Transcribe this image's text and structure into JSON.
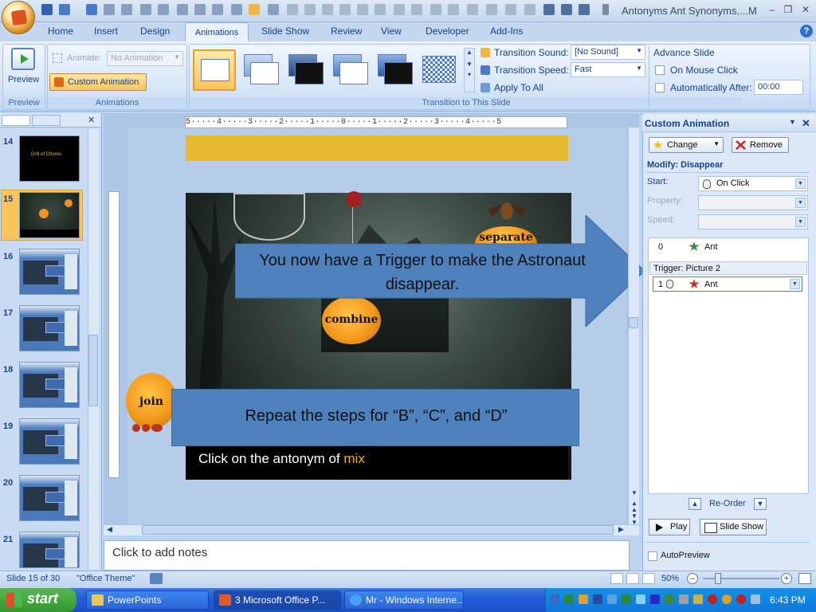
{
  "window": {
    "title": "Antonyms Ant Synonyms....M",
    "buttons": [
      "minimize",
      "restore",
      "close"
    ]
  },
  "ribbon_tabs": [
    "Home",
    "Insert",
    "Design",
    "Animations",
    "Slide Show",
    "Review",
    "View",
    "Developer",
    "Add-Ins"
  ],
  "active_tab": "Animations",
  "ribbon": {
    "preview": {
      "button": "Preview",
      "group": "Preview"
    },
    "animations": {
      "animate_label": "Animate:",
      "animate_value": "No Animation",
      "custom_animation": "Custom Animation",
      "group": "Animations"
    },
    "transition": {
      "sound_label": "Transition Sound:",
      "sound_value": "[No Sound]",
      "speed_label": "Transition Speed:",
      "speed_value": "Fast",
      "apply_all": "Apply To All",
      "group": "Transition to This Slide"
    },
    "advance": {
      "title": "Advance Slide",
      "on_click": "On Mouse Click",
      "auto_after": "Automatically After:",
      "time": "00:00"
    }
  },
  "slides_panel": {
    "slides": [
      {
        "number": "14",
        "kind": "dark",
        "caption": "Drill of Chores"
      },
      {
        "number": "15",
        "kind": "scene",
        "selected": true
      },
      {
        "number": "16",
        "kind": "blue"
      },
      {
        "number": "17",
        "kind": "blue"
      },
      {
        "number": "18",
        "kind": "blue"
      },
      {
        "number": "19",
        "kind": "blue"
      },
      {
        "number": "20",
        "kind": "blue"
      },
      {
        "number": "21",
        "kind": "blue"
      }
    ]
  },
  "ruler": "5·····4·····3·····2·····1·····0·····1·····2·····3·····4·····5",
  "slide": {
    "pumpkins": {
      "separate": "separate",
      "combine": "combine",
      "join": "join"
    },
    "bar_text_prefix": "Click on the antonym of ",
    "bar_text_highlight": "mix",
    "callout1": "You now have a Trigger to make the Astronaut disappear.",
    "callout2": "Repeat the steps for  “B”, “C”, and “D”"
  },
  "notes_placeholder": "Click to add notes",
  "task_pane": {
    "title": "Custom Animation",
    "change": "Change",
    "remove": "Remove",
    "modify": "Modify: Disappear",
    "start_label": "Start:",
    "start_value": "On Click",
    "property_label": "Property:",
    "speed_label": "Speed:",
    "items": [
      {
        "num": "0",
        "name": "Ant"
      },
      {
        "num": "1",
        "name": "Ant"
      }
    ],
    "trigger": "Trigger: Picture 2",
    "reorder": "Re-Order",
    "play": "Play",
    "slide_show": "Slide Show",
    "autopreview": "AutoPreview"
  },
  "status": {
    "slide": "Slide 15 of 30",
    "theme": "\"Office Theme\"",
    "zoom": "50%"
  },
  "taskbar": {
    "start": "start",
    "items": [
      {
        "label": "PowerPoints",
        "icon": "folder-icon"
      },
      {
        "label": "3 Microsoft Office P...",
        "icon": "powerpoint-icon"
      },
      {
        "label": "Mr - Windows Interne...",
        "icon": "ie-icon"
      }
    ],
    "clock": "6:43 PM"
  },
  "colors": {
    "ribbon": "#d3e3f6",
    "accent_gold": "#e8b830",
    "callout_blue": "#4f81bd",
    "highlight": "#f5b020",
    "taskbar": "#245edb"
  }
}
